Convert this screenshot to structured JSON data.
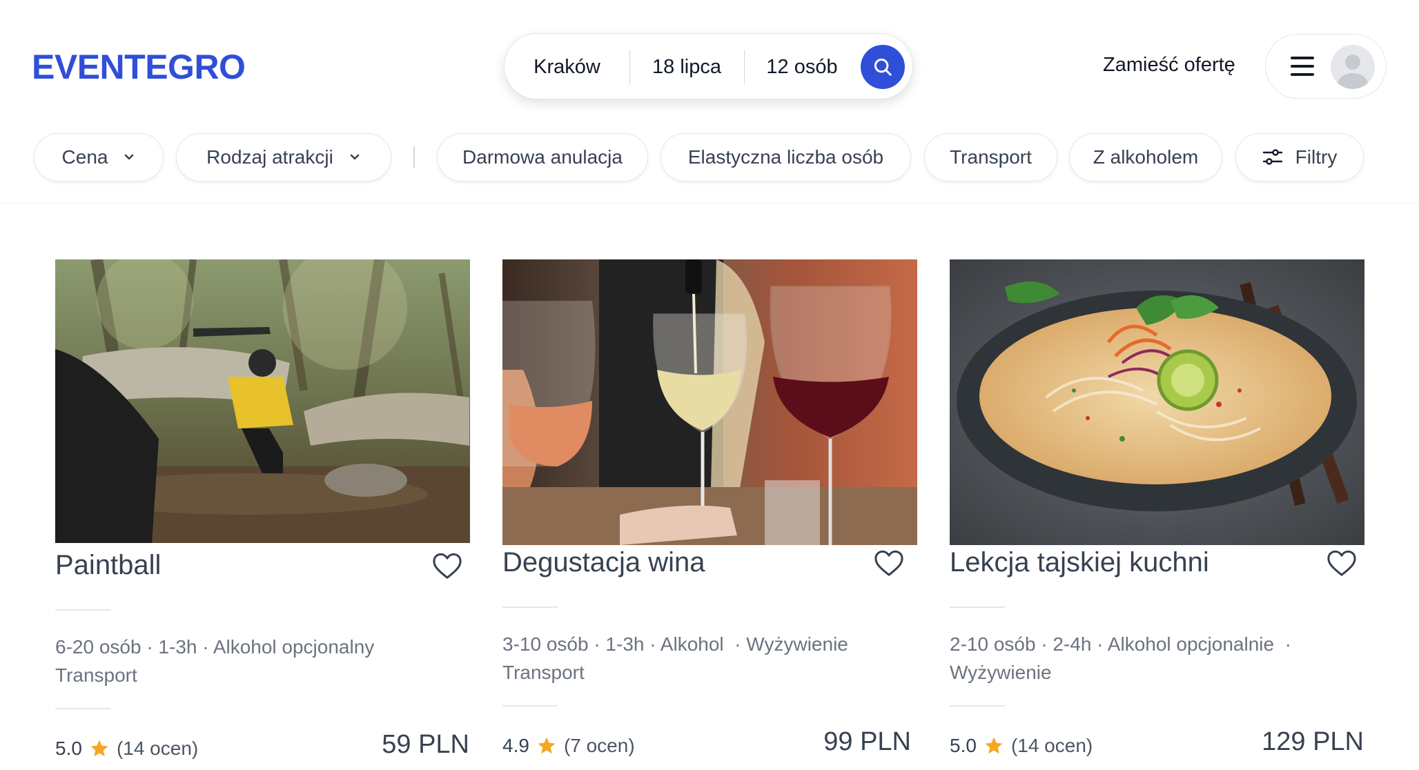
{
  "brand": {
    "logo_text": "EVENTEGRO",
    "accent_color": "#2f4fd8"
  },
  "search": {
    "location": "Kraków",
    "date": "18 lipca",
    "guests": "12 osób",
    "icon": "search-icon"
  },
  "header": {
    "post_offer_label": "Zamieść ofertę",
    "menu_icon": "hamburger-icon",
    "avatar_icon": "user-avatar-icon"
  },
  "filters": {
    "price_label": "Cena",
    "attraction_type_label": "Rodzaj atrakcji",
    "free_cancellation_label": "Darmowa anulacja",
    "flexible_group_label": "Elastyczna liczba osób",
    "transport_label": "Transport",
    "with_alcohol_label": "Z alkoholem",
    "more_filters_label": "Filtry"
  },
  "listings": [
    {
      "title": "Paintball",
      "features_line1": "6-20 osób · 1-3h · Alkohol opcjonalny",
      "features_line2": "Transport",
      "rating": "5.0",
      "reviews": "(14 ocen)",
      "price": "59 PLN",
      "rating_stars": 5.0
    },
    {
      "title": "Degustacja wina",
      "features_line1": "3-10 osób · 1-3h · Alkohol  · Wyżywienie",
      "features_line2": "Transport",
      "rating": "4.9",
      "reviews": "(7 ocen)",
      "price": "99 PLN",
      "rating_stars": 4.9
    },
    {
      "title": "Lekcja tajskiej kuchni",
      "features_line1": "2-10 osób · 2-4h · Alkohol opcjonalnie  ·",
      "features_line2": "Wyżywienie",
      "rating": "5.0",
      "reviews": "(14 ocen)",
      "price": "129 PLN",
      "rating_stars": 5.0
    }
  ],
  "colors": {
    "star": "#f5a623",
    "text_muted": "#6b7280",
    "border": "#e5e7eb"
  }
}
